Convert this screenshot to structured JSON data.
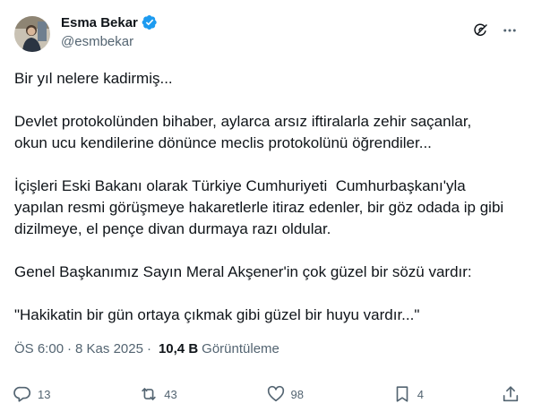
{
  "author": {
    "name": "Esma Bekar",
    "handle": "@esmbekar"
  },
  "post": {
    "paragraphs": [
      "Bir yıl nelere kadirmiş...",
      "Devlet protokolünden bihaber, aylarca arsız iftiralarla zehir saçanlar,\nokun ucu kendilerine dönünce meclis protokolünü öğrendiler...",
      "İçişleri Eski Bakanı olarak Türkiye Cumhuriyeti  Cumhurbaşkanı'yla\nyapılan resmi görüşmeye hakaretlerle itiraz edenler, bir göz odada ip gibi\ndizilmeye, el pençe divan durmaya razı oldular.",
      "Genel Başkanımız Sayın Meral Akşener'in çok güzel bir sözü vardır:",
      "\"Hakikatin bir gün ortaya çıkmak gibi güzel bir huyu vardır...\""
    ]
  },
  "meta": {
    "time": "ÖS 6:00",
    "separator": "·",
    "date": "8 Kas 2025",
    "views_count": "10,4 B",
    "views_label": "Görüntüleme"
  },
  "stats": {
    "replies": "13",
    "reposts": "43",
    "likes": "98",
    "bookmarks": "4"
  },
  "icons": {
    "verified": "verified-badge-icon",
    "grok": "grok-icon",
    "more": "more-icon",
    "reply": "reply-icon",
    "repost": "repost-icon",
    "like": "heart-icon",
    "bookmark": "bookmark-icon",
    "share": "share-icon"
  },
  "colors": {
    "text": "#0f1419",
    "secondary": "#536471",
    "verified": "#1d9bf0"
  }
}
